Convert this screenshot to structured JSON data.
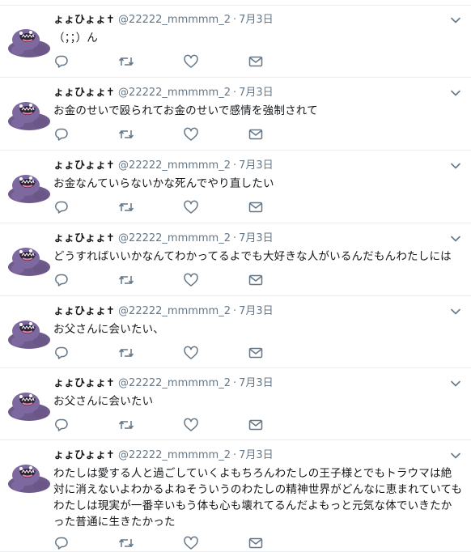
{
  "colors": {
    "icon": "#657786",
    "divider": "#e6ecf0",
    "text": "#14171a",
    "avatar": "#6e5b8c"
  },
  "avatar_icon": "muk-pokemon-avatar",
  "tweets": [
    {
      "display_name": "ょょひょょ✝",
      "handle": "@22222_mmmmm_2",
      "separator": "·",
      "time": "7月3日",
      "text": "（；；）ん"
    },
    {
      "display_name": "ょょひょょ✝",
      "handle": "@22222_mmmmm_2",
      "separator": "·",
      "time": "7月3日",
      "text": "お金のせいで殴られてお金のせいで感情を強制されて"
    },
    {
      "display_name": "ょょひょょ✝",
      "handle": "@22222_mmmmm_2",
      "separator": "·",
      "time": "7月3日",
      "text": "お金なんていらないかな死んでやり直したい"
    },
    {
      "display_name": "ょょひょょ✝",
      "handle": "@22222_mmmmm_2",
      "separator": "·",
      "time": "7月3日",
      "text": "どうすればいいかなんてわかってるよでも大好きな人がいるんだもんわたしには"
    },
    {
      "display_name": "ょょひょょ✝",
      "handle": "@22222_mmmmm_2",
      "separator": "·",
      "time": "7月3日",
      "text": "お父さんに会いたい、"
    },
    {
      "display_name": "ょょひょょ✝",
      "handle": "@22222_mmmmm_2",
      "separator": "·",
      "time": "7月3日",
      "text": "お父さんに会いたい"
    },
    {
      "display_name": "ょょひょょ✝",
      "handle": "@22222_mmmmm_2",
      "separator": "·",
      "time": "7月3日",
      "text": "わたしは愛する人と過ごしていくよもちろんわたしの王子様とでもトラウマは絶対に消えないよわかるよねそういうのわたしの精神世界がどんなに恵まれていてもわたしは現実が一番辛いもう体も心も壊れてるんだよもっと元気な体でいきたかった普通に生きたかった"
    }
  ]
}
